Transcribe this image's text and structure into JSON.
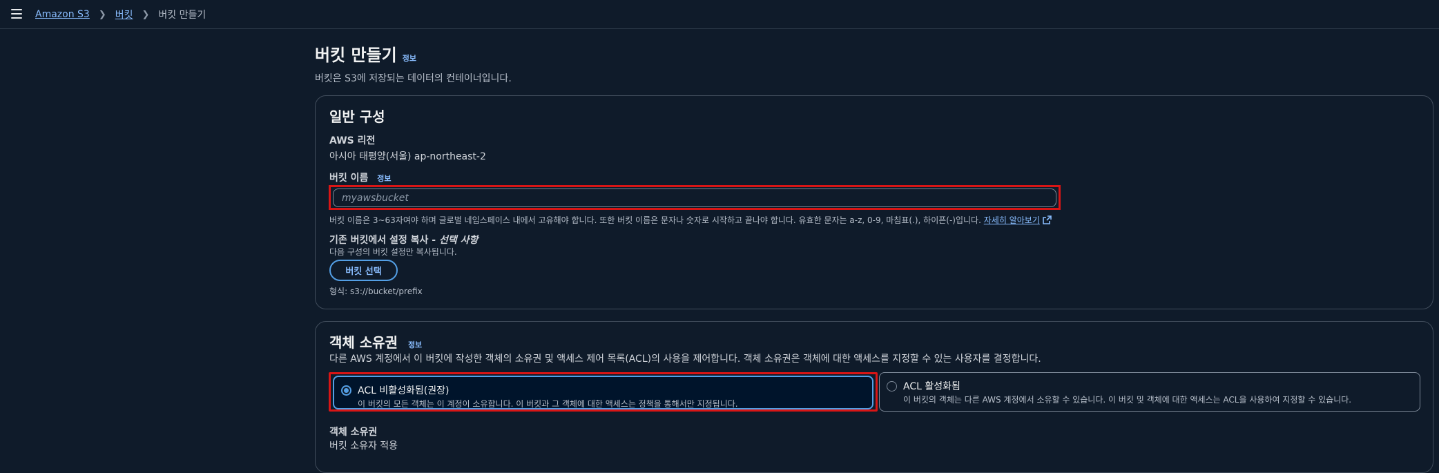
{
  "breadcrumb": {
    "items": [
      "Amazon S3",
      "버킷"
    ],
    "current": "버킷 만들기"
  },
  "page": {
    "title": "버킷 만들기",
    "info": "정보",
    "description": "버킷은 S3에 저장되는 데이터의 컨테이너입니다."
  },
  "general": {
    "title": "일반 구성",
    "region_label": "AWS 리전",
    "region_value": "아시아 태평양(서울) ap-northeast-2",
    "bucket_name_label": "버킷 이름",
    "bucket_name_info": "정보",
    "bucket_name_placeholder": "myawsbucket",
    "bucket_name_value": "",
    "bucket_name_hint": "버킷 이름은 3~63자여야 하며 글로벌 네임스페이스 내에서 고유해야 합니다. 또한 버킷 이름은 문자나 숫자로 시작하고 끝나야 합니다. 유효한 문자는 a-z, 0-9, 마침표(.), 하이픈(-)입니다.",
    "learn_more": "자세히 알아보기",
    "copy_label": "기존 버킷에서 설정 복사 - ",
    "copy_optional": "선택 사항",
    "copy_hint": "다음 구성의 버킷 설정만 복사됩니다.",
    "choose_bucket_button": "버킷 선택",
    "format_hint": "형식: s3://bucket/prefix"
  },
  "ownership": {
    "title": "객체 소유권",
    "info": "정보",
    "description": "다른 AWS 계정에서 이 버킷에 작성한 객체의 소유권 및 액세스 제어 목록(ACL)의 사용을 제어합니다. 객체 소유권은 객체에 대한 액세스를 지정할 수 있는 사용자를 결정합니다.",
    "options": [
      {
        "title": "ACL 비활성화됨(권장)",
        "description": "이 버킷의 모든 객체는 이 계정이 소유합니다. 이 버킷과 그 객체에 대한 액세스는 정책을 통해서만 지정됩니다.",
        "selected": true
      },
      {
        "title": "ACL 활성화됨",
        "description": "이 버킷의 객체는 다른 AWS 계정에서 소유할 수 있습니다. 이 버킷 및 객체에 대한 액세스는 ACL을 사용하여 지정할 수 있습니다.",
        "selected": false
      }
    ],
    "owner_label": "객체 소유권",
    "owner_value": "버킷 소유자 적용"
  },
  "colors": {
    "background": "#0f1b2a",
    "link": "#89bdff",
    "accent": "#539fe5",
    "highlight": "#d91515"
  }
}
